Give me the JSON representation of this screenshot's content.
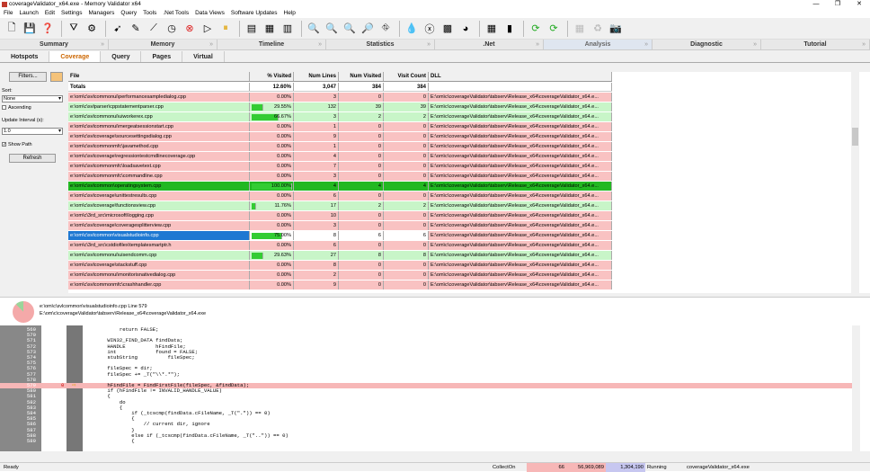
{
  "window": {
    "title": "coverageValidator_x64.exe - Memory Validator x64",
    "min": "—",
    "max": "❐",
    "close": "✕"
  },
  "menu": [
    "File",
    "Launch",
    "Edit",
    "Settings",
    "Managers",
    "Query",
    "Tools",
    ".Net Tools",
    "Data Views",
    "Software Updates",
    "Help"
  ],
  "main_tabs": [
    "Summary",
    "Memory",
    "Timeline",
    "Statistics",
    ".Net",
    "Analysis",
    "Diagnostic",
    "Tutorial"
  ],
  "active_main_tab": "Analysis",
  "sub_tabs": [
    "Hotspots",
    "Coverage",
    "Query",
    "Pages",
    "Virtual"
  ],
  "active_sub_tab": "Coverage",
  "left": {
    "filters": "Filters...",
    "sort_label": "Sort:",
    "sort_value": "None",
    "ascending": "Ascending",
    "update_label": "Update Interval (s):",
    "update_value": "1.0",
    "show_path": "Show Path",
    "refresh": "Refresh"
  },
  "grid": {
    "columns": [
      "File",
      "% Visited",
      "Num Lines",
      "Num Visited",
      "Visit Count",
      "DLL"
    ],
    "totals": {
      "label": "Totals",
      "pct": "12.60%",
      "lines": "3,047",
      "visited": "384",
      "count": "384"
    },
    "rows": [
      {
        "file": "e:\\om\\c\\svlcommonui\\performancesampledialog.cpp",
        "pct": "0.00%",
        "pv": 0,
        "lines": "3",
        "visited": "0",
        "count": "0",
        "dll": "E:\\om\\c\\coverageValidator\\tabserv\\Release_x64\\coverageValidator_x64.e...",
        "color": "red"
      },
      {
        "file": "e:\\om\\c\\svlparser\\cppstatementparser.cpp",
        "pct": "29.55%",
        "pv": 29.55,
        "lines": "132",
        "visited": "39",
        "count": "39",
        "dll": "E:\\om\\c\\coverageValidator\\tabserv\\Release_x64\\coverageValidator_x64.e...",
        "color": "green"
      },
      {
        "file": "e:\\om\\c\\svlcommonui\\uiworkerex.cpp",
        "pct": "66.67%",
        "pv": 66.67,
        "lines": "3",
        "visited": "2",
        "count": "2",
        "dll": "E:\\om\\c\\coverageValidator\\tabserv\\Release_x64\\coverageValidator_x64.e...",
        "color": "green"
      },
      {
        "file": "e:\\om\\c\\svlcommonui\\mergeatsessionstart.cpp",
        "pct": "0.00%",
        "pv": 0,
        "lines": "1",
        "visited": "0",
        "count": "0",
        "dll": "E:\\om\\c\\coverageValidator\\tabserv\\Release_x64\\coverageValidator_x64.e...",
        "color": "red"
      },
      {
        "file": "e:\\om\\c\\svlcoverage\\sourcesettingsdialog.cpp",
        "pct": "0.00%",
        "pv": 0,
        "lines": "9",
        "visited": "0",
        "count": "0",
        "dll": "E:\\om\\c\\coverageValidator\\tabserv\\Release_x64\\coverageValidator_x64.e...",
        "color": "red"
      },
      {
        "file": "e:\\om\\c\\svlcommonmfc\\javamethod.cpp",
        "pct": "0.00%",
        "pv": 0,
        "lines": "1",
        "visited": "0",
        "count": "0",
        "dll": "E:\\om\\c\\coverageValidator\\tabserv\\Release_x64\\coverageValidator_x64.e...",
        "color": "red"
      },
      {
        "file": "e:\\om\\c\\svlcoverage\\regressiontestcmdlinecoverage.cpp",
        "pct": "0.00%",
        "pv": 0,
        "lines": "4",
        "visited": "0",
        "count": "0",
        "dll": "E:\\om\\c\\coverageValidator\\tabserv\\Release_x64\\coverageValidator_x64.e...",
        "color": "red"
      },
      {
        "file": "e:\\om\\c\\svlcommonmfc\\loadsavetext.cpp",
        "pct": "0.00%",
        "pv": 0,
        "lines": "7",
        "visited": "0",
        "count": "0",
        "dll": "E:\\om\\c\\coverageValidator\\tabserv\\Release_x64\\coverageValidator_x64.e...",
        "color": "red"
      },
      {
        "file": "e:\\om\\c\\svlcommonmfc\\commandline.cpp",
        "pct": "0.00%",
        "pv": 0,
        "lines": "3",
        "visited": "0",
        "count": "0",
        "dll": "E:\\om\\c\\coverageValidator\\tabserv\\Release_x64\\coverageValidator_x64.e...",
        "color": "red"
      },
      {
        "file": "e:\\om\\c\\svlcommon\\operatingsystem.cpp",
        "pct": "100.00%",
        "pv": 100,
        "lines": "4",
        "visited": "4",
        "count": "4",
        "dll": "E:\\om\\c\\coverageValidator\\tabserv\\Release_x64\\coverageValidator_x64.e...",
        "color": "full"
      },
      {
        "file": "e:\\om\\c\\svlcoverage\\unittestresults.cpp",
        "pct": "0.00%",
        "pv": 0,
        "lines": "6",
        "visited": "0",
        "count": "0",
        "dll": "E:\\om\\c\\coverageValidator\\tabserv\\Release_x64\\coverageValidator_x64.e...",
        "color": "red"
      },
      {
        "file": "e:\\om\\c\\svlcoverage\\functionsview.cpp",
        "pct": "11.76%",
        "pv": 11.76,
        "lines": "17",
        "visited": "2",
        "count": "2",
        "dll": "E:\\om\\c\\coverageValidator\\tabserv\\Release_x64\\coverageValidator_x64.e...",
        "color": "green"
      },
      {
        "file": "e:\\om\\c\\3rd_src\\microsoft\\logging.cpp",
        "pct": "0.00%",
        "pv": 0,
        "lines": "10",
        "visited": "0",
        "count": "0",
        "dll": "E:\\om\\c\\coverageValidator\\tabserv\\Release_x64\\coverageValidator_x64.e...",
        "color": "red"
      },
      {
        "file": "e:\\om\\c\\svlcoverage\\coveragesplitterview.cpp",
        "pct": "0.00%",
        "pv": 0,
        "lines": "3",
        "visited": "0",
        "count": "0",
        "dll": "E:\\om\\c\\coverageValidator\\tabserv\\Release_x64\\coverageValidator_x64.e...",
        "color": "red"
      },
      {
        "file": "e:\\om\\c\\svlcommon\\visualstudioinfo.cpp",
        "pct": "75.00%",
        "pv": 75,
        "lines": "8",
        "visited": "6",
        "count": "6",
        "dll": "E:\\om\\c\\coverageValidator\\tabserv\\Release_x64\\coverageValidator_x64.e...",
        "color": "selected"
      },
      {
        "file": "e:\\om\\c\\3rd_src\\cstdiofilex\\templatesmartptr.h",
        "pct": "0.00%",
        "pv": 0,
        "lines": "6",
        "visited": "0",
        "count": "0",
        "dll": "E:\\om\\c\\coverageValidator\\tabserv\\Release_x64\\coverageValidator_x64.e...",
        "color": "red"
      },
      {
        "file": "e:\\om\\c\\svlcommonui\\uisendcomm.cpp",
        "pct": "29.63%",
        "pv": 29.63,
        "lines": "27",
        "visited": "8",
        "count": "8",
        "dll": "E:\\om\\c\\coverageValidator\\tabserv\\Release_x64\\coverageValidator_x64.e...",
        "color": "green"
      },
      {
        "file": "e:\\om\\c\\svlcoverage\\stackstuff.cpp",
        "pct": "0.00%",
        "pv": 0,
        "lines": "8",
        "visited": "0",
        "count": "0",
        "dll": "E:\\om\\c\\coverageValidator\\tabserv\\Release_x64\\coverageValidator_x64.e...",
        "color": "red"
      },
      {
        "file": "e:\\om\\c\\svlcommonui\\monitorisnativedialog.cpp",
        "pct": "0.00%",
        "pv": 0,
        "lines": "2",
        "visited": "0",
        "count": "0",
        "dll": "E:\\om\\c\\coverageValidator\\tabserv\\Release_x64\\coverageValidator_x64.e...",
        "color": "red"
      },
      {
        "file": "e:\\om\\c\\svlcommonmfc\\crashhandler.cpp",
        "pct": "0.00%",
        "pv": 0,
        "lines": "9",
        "visited": "0",
        "count": "0",
        "dll": "E:\\om\\c\\coverageValidator\\tabserv\\Release_x64\\coverageValidator_x64.e...",
        "color": "red"
      }
    ]
  },
  "mid": {
    "line1": "e:\\om\\c\\svlcommon\\visualstudioinfo.cpp Line 579",
    "line2": "E:\\om\\c\\coverageValidator\\tabserv\\Release_x64\\coverageValidator_x64.exe"
  },
  "code": [
    {
      "n": "569",
      "t": "        return FALSE;",
      "cls": "kwline"
    },
    {
      "n": "570",
      "t": ""
    },
    {
      "n": "571",
      "t": "    WIN32_FIND_DATA findData;"
    },
    {
      "n": "572",
      "t": "    HANDLE          hFindFile;"
    },
    {
      "n": "573",
      "t": "    int             found = FALSE;"
    },
    {
      "n": "574",
      "t": "    stubString          fileSpec;"
    },
    {
      "n": "575",
      "t": ""
    },
    {
      "n": "576",
      "t": "    fileSpec = dir;"
    },
    {
      "n": "577",
      "t": "    fileSpec += _T(\"\\\\*.*\");"
    },
    {
      "n": "578",
      "t": ""
    },
    {
      "n": "579",
      "t": "    hFindFile = FindFirstFile(fileSpec, &findData);",
      "hl": true,
      "count": "0"
    },
    {
      "n": "580",
      "t": "    if (hFindFile != INVALID_HANDLE_VALUE)"
    },
    {
      "n": "581",
      "t": "    {"
    },
    {
      "n": "582",
      "t": "        do"
    },
    {
      "n": "583",
      "t": "        {"
    },
    {
      "n": "584",
      "t": "            if (_tcscmp(findData.cFileName, _T(\".\")) == 0)"
    },
    {
      "n": "585",
      "t": "            {"
    },
    {
      "n": "586",
      "t": "                // current dir, ignore",
      "cm": true
    },
    {
      "n": "587",
      "t": "            }"
    },
    {
      "n": "588",
      "t": "            else if (_tcscmp(findData.cFileName, _T(\"..\")) == 0)"
    },
    {
      "n": "589",
      "t": "            {"
    }
  ],
  "status": {
    "ready": "Ready",
    "collect": "CollectOn",
    "v1": "66",
    "v2": "56,969,089",
    "v3": "1,304,190",
    "running": "Running",
    "exe": "coverageValidator_x64.exe"
  },
  "colors": {
    "red": "#f9c2c2",
    "green": "#c8f5c8",
    "full": "#22b822",
    "selected": "#1e78d2",
    "bar": "#33cc33"
  }
}
